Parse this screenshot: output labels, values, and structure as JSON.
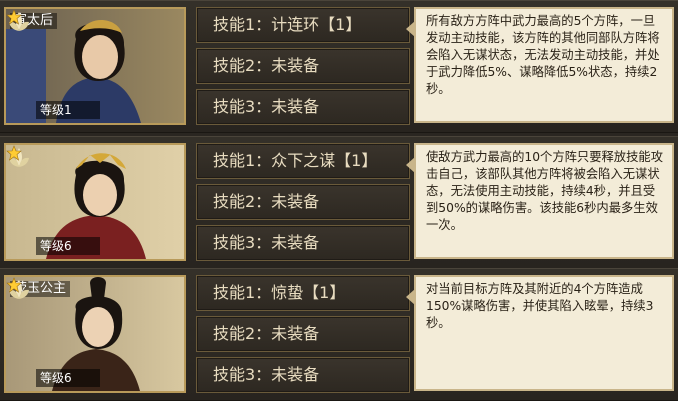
{
  "generals": [
    {
      "name": "宣太后",
      "level_label": "等级1",
      "skills": [
        "技能1：计连环【1】",
        "技能2：未装备",
        "技能3：未装备"
      ],
      "description": "所有敌方方阵中武力最高的5个方阵，一旦发动主动技能，该方阵的其他同部队方阵将会陷入无谋状态，无法发动主动技能，并处于武力降低5%、谋略降低5%状态，持续2秒。"
    },
    {
      "name": "",
      "level_label": "等级6",
      "skills": [
        "技能1：众下之谋【1】",
        "技能2：未装备",
        "技能3：未装备"
      ],
      "description": "使敌方武力最高的10个方阵只要释放技能攻击自己，该部队其他方阵将被会陷入无谋状态，无法使用主动技能，持续4秒，并且受到50%的谋略伤害。该技能6秒内最多生效一次。"
    },
    {
      "name": "荧玉公主",
      "level_label": "等级6",
      "skills": [
        "技能1：惊蛰【1】",
        "技能2：未装备",
        "技能3：未装备"
      ],
      "description": "对当前目标方阵及其附近的4个方阵造成150%谋略伤害，并使其陷入眩晕，持续3秒。"
    }
  ],
  "colors": {
    "frame_gold": "#b89a5a",
    "desc_bg": "#f3ecd8",
    "skill_text": "#e8dcc0"
  }
}
